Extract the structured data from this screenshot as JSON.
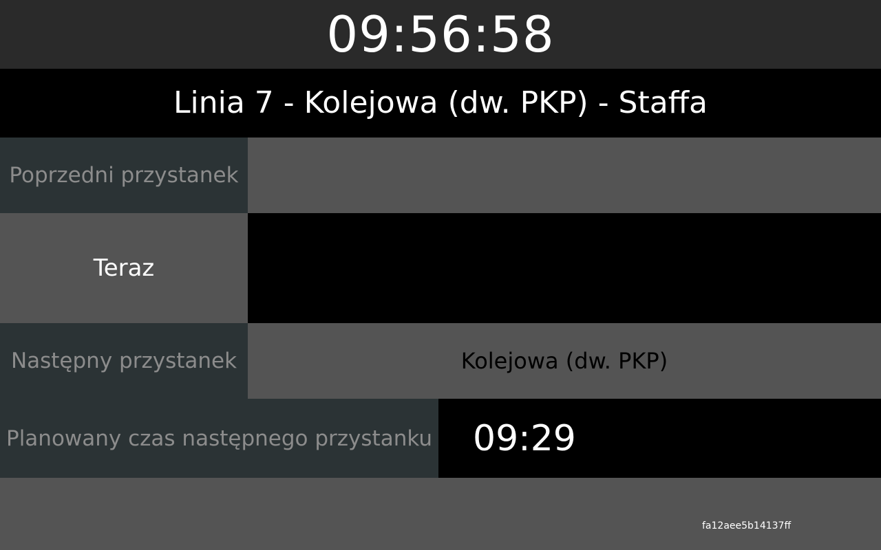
{
  "clock": {
    "time": "09:56:58"
  },
  "line": {
    "title": "Linia 7 - Kolejowa (dw. PKP) - Staffa"
  },
  "previous_stop": {
    "label": "Poprzedni przystanek",
    "value": ""
  },
  "current_stop": {
    "label": "Teraz",
    "value": ""
  },
  "next_stop": {
    "label": "Następny przystanek",
    "value": "Kolejowa (dw. PKP)"
  },
  "planned_time": {
    "label": "Planowany czas następnego przystanku",
    "value": "09:29"
  },
  "footer": {
    "device_id": "fa12aee5b14137ff"
  },
  "colors": {
    "clock_bar": "#2a2a2a",
    "line_bar": "#000000",
    "label_dark": "#2b3335",
    "panel_gray": "#545454",
    "label_text": "#8c8c8c",
    "highlight_text": "#ffffff"
  }
}
